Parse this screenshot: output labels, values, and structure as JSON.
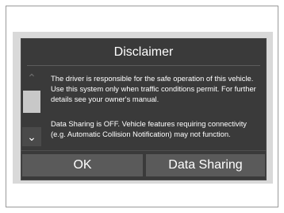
{
  "dialog": {
    "title": "Disclaimer",
    "paragraphs": [
      "The driver is responsible for the safe operation of this vehicle. Use this system only when traffic conditions permit. For further details see your owner's manual.",
      "Data Sharing is OFF. Vehicle features requiring connectivity (e.g. Automatic Collision Notification) may not function."
    ],
    "buttons": {
      "ok_label": "OK",
      "data_sharing_label": "Data Sharing"
    }
  },
  "icons": {
    "scroll_up": "chevron-up-icon",
    "scroll_down": "chevron-down-icon"
  },
  "colors": {
    "dialog_bg": "#3a3a3a",
    "button_bg": "#5a5a5a",
    "screen_bg": "#d9d9d9"
  }
}
